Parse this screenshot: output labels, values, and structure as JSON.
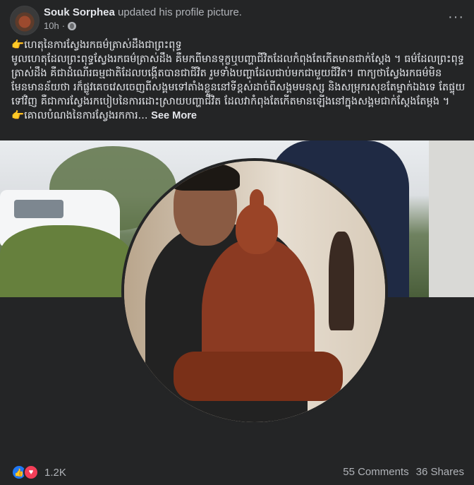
{
  "post": {
    "author_name": "Souk Sorphea",
    "action": "updated his profile picture.",
    "time": "10h",
    "separator": "·",
    "more": "···",
    "text": [
      "👉ហេតុនៃការស្វែងរកធម៌ត្រាស់ដឹងជាព្រះពុទ្ធ",
      "មូលហេតុដែលព្រះពុទ្ធស្វែងរកធម៌ត្រាស់ដឹង គឺមកពីមានទុក្ខឬបញ្ហាជីវិតដែលកំពុងតែកើតមានជាក់ស្តែង ។ ធម៌ដែលព្រះពុទ្ធត្រាស់ដឹង គឺជាដំណើរធម្មជាតិដែលបង្កើតបានជាជីវិត រួមទាំងបញ្ហាដែលជាប់មកជាមួយជីវិត។ ពាក្យថាស្វែងរកធម៌មិនមែនមានន័យថា រក៏ផ្លូវគេចវេសចេញពីសង្គមទៅតាំងខ្លួននៅទីខ្ពស់ដាច់ពីសង្គមមនុស្ស និងសម្រុករសុខតែម្នាក់ឯងទេ តែផ្ទុយទៅវិញ គឺជាការស្វែងរកបៀបនៃការដោះស្រាយបញ្ហាជីវិត ដែលវាកំពុងតែកើតមានឡើងនៅក្នុងសង្គមជាក់ស្តែងតែម្តង ។",
      "👉គោលបំណងនៃការស្វែងរកការ..."
    ],
    "see_more": "See More"
  },
  "icons": {
    "avatar": "avatar-image",
    "globe": "globe-icon",
    "like": "like-icon",
    "love": "love-icon",
    "more": "more-options-icon"
  },
  "footer": {
    "like_glyph": "👍",
    "love_glyph": "♥",
    "reaction_count": "1.2K",
    "comments": "55 Comments",
    "shares": "36 Shares"
  },
  "colors": {
    "background": "#242526",
    "text_primary": "#e4e6eb",
    "text_secondary": "#b0b3b8",
    "like_blue": "#2078f4",
    "love_red": "#f33e58"
  }
}
